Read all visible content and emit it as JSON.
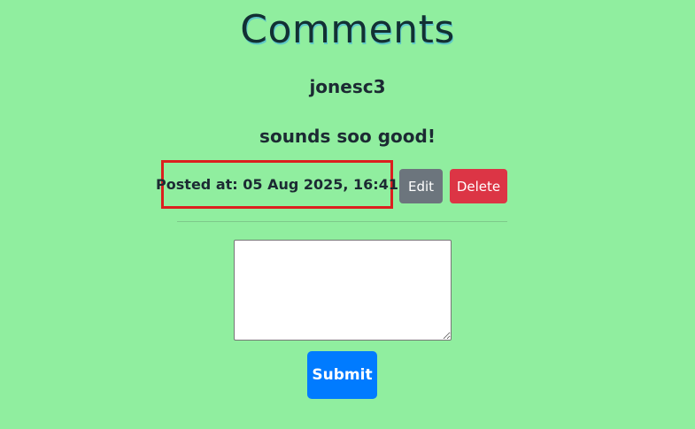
{
  "page": {
    "title": "Comments"
  },
  "comment": {
    "username": "jonesc3",
    "body": "sounds soo good!",
    "posted_at": "Posted at: 05 Aug 2025, 16:41",
    "edit_label": "Edit",
    "delete_label": "Delete"
  },
  "form": {
    "textarea_value": "",
    "submit_label": "Submit"
  },
  "colors": {
    "background": "#90ee9f",
    "edit_button": "#6c757d",
    "delete_button": "#dc3545",
    "submit_button": "#007bff",
    "highlight_border": "#dc1f1f"
  }
}
